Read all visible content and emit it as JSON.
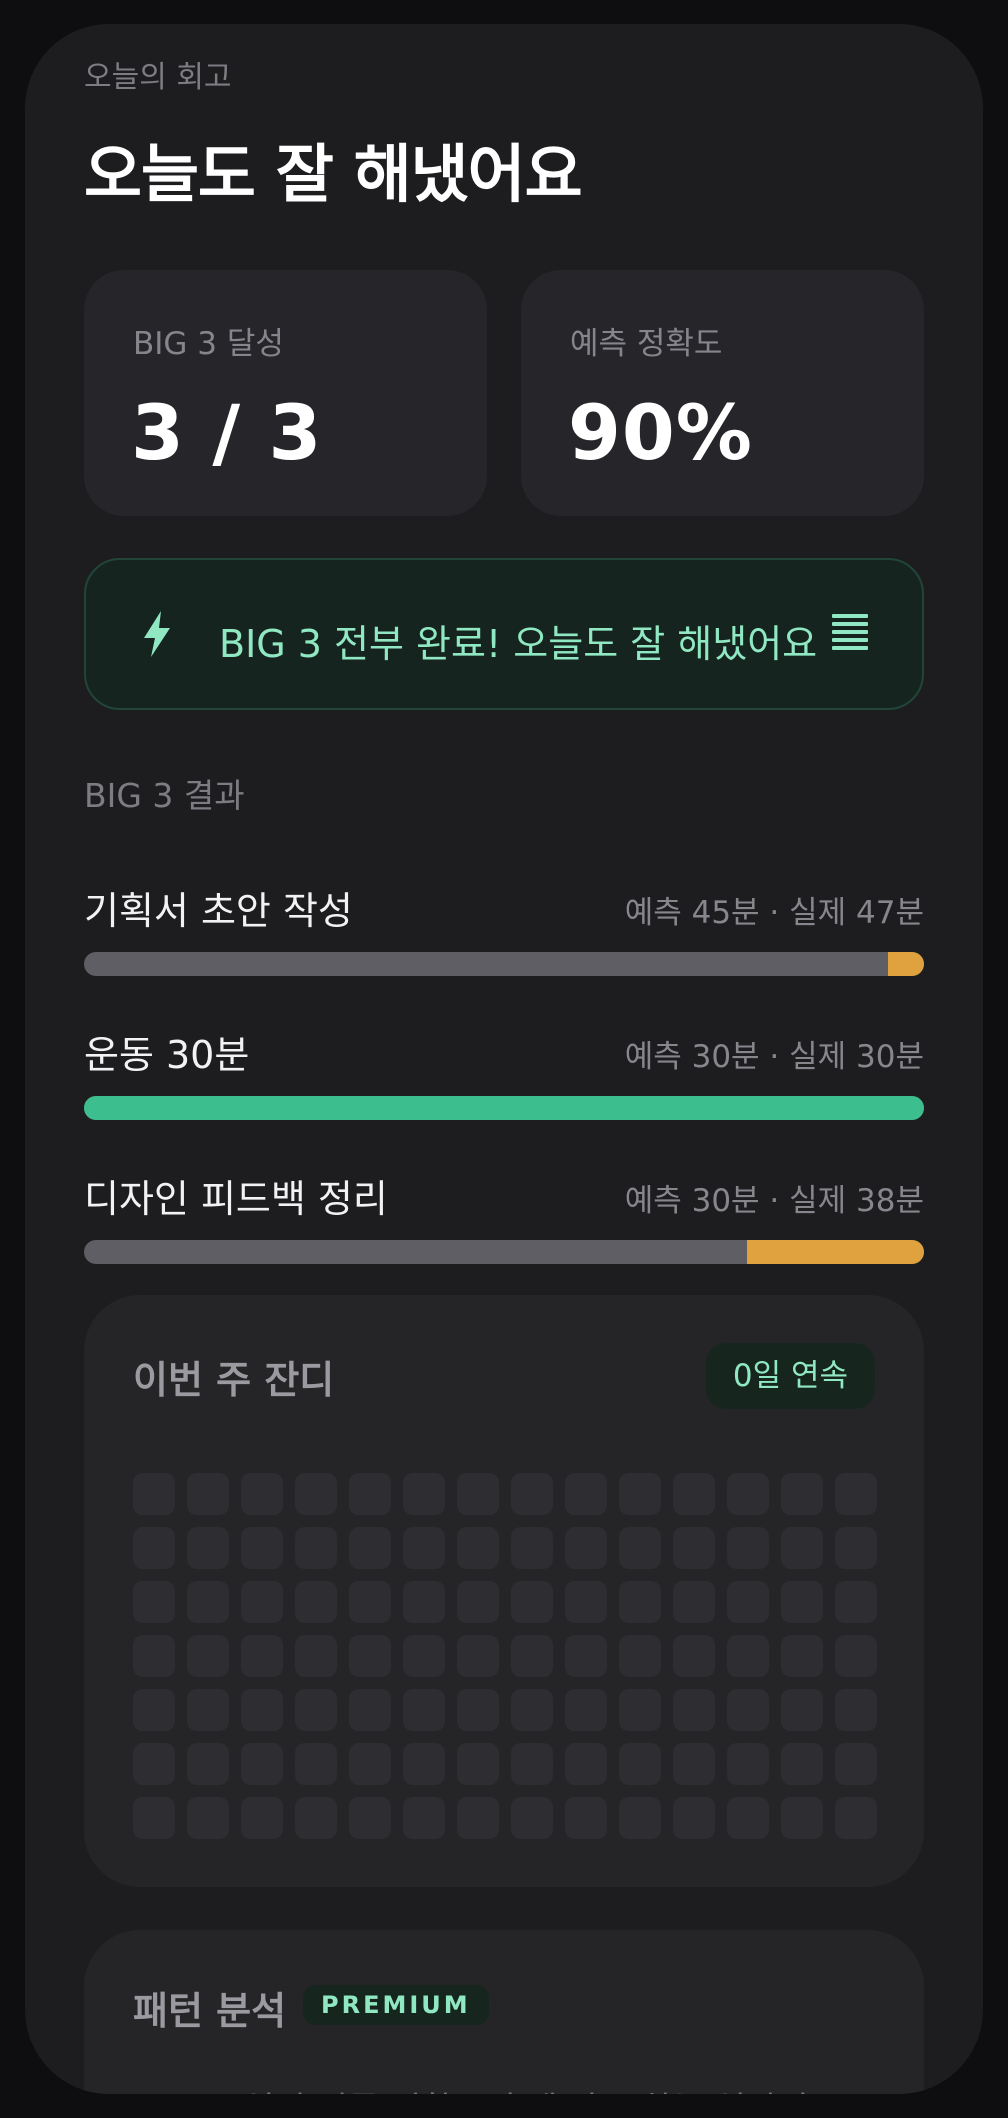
{
  "header": {
    "kicker": "오늘의 회고",
    "title": "오늘도 잘 해냈어요"
  },
  "stats": [
    {
      "label": "BIG 3 달성",
      "value": "3 / 3"
    },
    {
      "label": "예측 정확도",
      "value": "90%"
    }
  ],
  "banner": {
    "text": "BIG 3 전부 완료! 오늘도 잘 해냈어요",
    "icon": "lightning-bolt-icon"
  },
  "results": {
    "label": "BIG 3 결과",
    "items": [
      {
        "name": "기획서 초안 작성",
        "meta": "예측 45분 · 실제 47분",
        "predicted": 45,
        "actual": 47
      },
      {
        "name": "운동 30분",
        "meta": "예측 30분 · 실제 30분",
        "predicted": 30,
        "actual": 30
      },
      {
        "name": "디자인 피드백 정리",
        "meta": "예측 30분 · 실제 38분",
        "predicted": 30,
        "actual": 38
      }
    ]
  },
  "grass": {
    "title": "이번 주 잔디",
    "streak": "0일 연속",
    "rows": 7,
    "cols": 14
  },
  "pattern": {
    "title": "패턴 분석",
    "badge": "PREMIUM",
    "desc": "요일별 리듬·정확도 추세·자주 하는 일까지 —",
    "icon": "lock-icon"
  },
  "colors": {
    "accent": "#8fe8c2",
    "success": "#3dbe8e",
    "over": "#e0a23e",
    "track": "#5e5e64"
  }
}
